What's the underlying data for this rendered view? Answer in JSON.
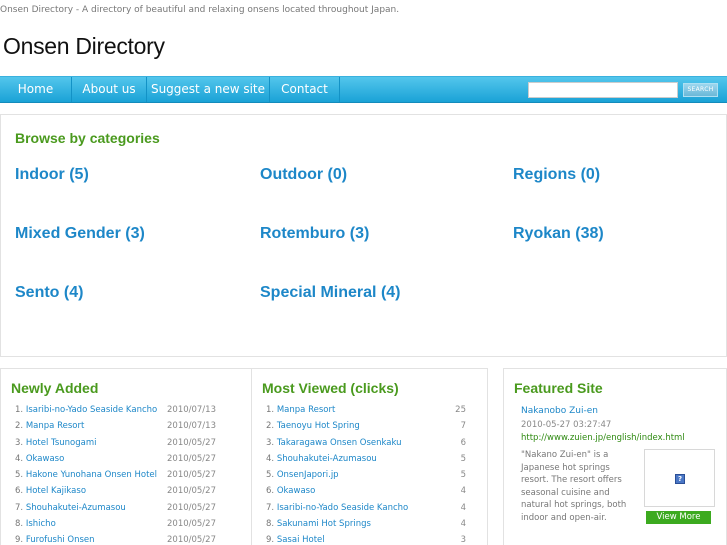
{
  "header": {
    "tagline": "Onsen Directory - A directory of beautiful and relaxing onsens located throughout Japan.",
    "title": "Onsen Directory"
  },
  "nav": {
    "items": [
      "Home",
      "About us",
      "Suggest a new site",
      "Contact"
    ],
    "search_placeholder": "",
    "search_button": "SEARCH"
  },
  "categories": {
    "heading": "Browse by categories",
    "items": [
      "Indoor (5)",
      "Outdoor (0)",
      "Regions (0)",
      "Mixed Gender (3)",
      "Rotemburo (3)",
      "Ryokan (38)",
      "Sento (4)",
      "Special Mineral (4)"
    ]
  },
  "newly_added": {
    "heading": "Newly Added",
    "items": [
      {
        "index": "1.",
        "name": "Isaribi-no-Yado Seaside Kancho",
        "date": "2010/07/13"
      },
      {
        "index": "2.",
        "name": "Manpa Resort",
        "date": "2010/07/13"
      },
      {
        "index": "3.",
        "name": "Hotel Tsunogami",
        "date": "2010/05/27"
      },
      {
        "index": "4.",
        "name": "Okawaso",
        "date": "2010/05/27"
      },
      {
        "index": "5.",
        "name": "Hakone Yunohana Onsen Hotel",
        "date": "2010/05/27"
      },
      {
        "index": "6.",
        "name": "Hotel Kajikaso",
        "date": "2010/05/27"
      },
      {
        "index": "7.",
        "name": "Shouhakutei-Azumasou",
        "date": "2010/05/27"
      },
      {
        "index": "8.",
        "name": "Ishicho",
        "date": "2010/05/27"
      },
      {
        "index": "9.",
        "name": "Furofushi Onsen",
        "date": "2010/05/27"
      }
    ]
  },
  "most_viewed": {
    "heading": "Most Viewed (clicks)",
    "items": [
      {
        "index": "1.",
        "name": "Manpa Resort",
        "clicks": "25"
      },
      {
        "index": "2.",
        "name": "Taenoyu Hot Spring",
        "clicks": "7"
      },
      {
        "index": "3.",
        "name": "Takaragawa Onsen Osenkaku",
        "clicks": "6"
      },
      {
        "index": "4.",
        "name": "Shouhakutei-Azumasou",
        "clicks": "5"
      },
      {
        "index": "5.",
        "name": "OnsenJapori.jp",
        "clicks": "5"
      },
      {
        "index": "6.",
        "name": "Okawaso",
        "clicks": "4"
      },
      {
        "index": "7.",
        "name": "Isaribi-no-Yado Seaside Kancho",
        "clicks": "4"
      },
      {
        "index": "8.",
        "name": "Sakunami Hot Springs",
        "clicks": "4"
      },
      {
        "index": "9.",
        "name": "Sasai Hotel",
        "clicks": "3"
      }
    ]
  },
  "featured": {
    "heading": "Featured Site",
    "name": "Nakanobo Zui-en",
    "date": "2010-05-27 03:27:47",
    "url": "http://www.zuien.jp/english/index.html",
    "description": "\"Nakano Zui-en\" is a Japanese hot springs resort. The resort offers seasonal cuisine and natural hot springs, both indoor and open-air.",
    "thumb_icon": "?",
    "view_more": "View More"
  }
}
